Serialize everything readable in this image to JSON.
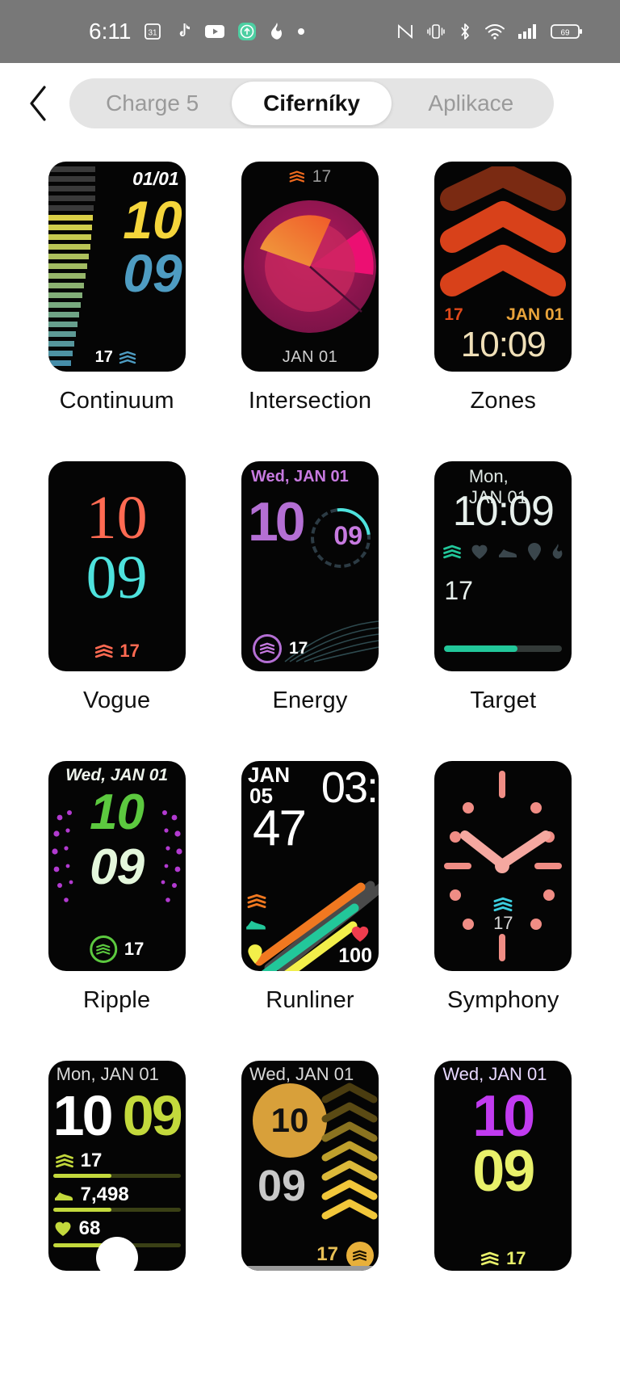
{
  "status_bar": {
    "time": "6:11",
    "left_icons": [
      "calendar-31-icon",
      "tiktok-icon",
      "youtube-icon",
      "upload-arrow-icon",
      "flame-icon",
      "dot-icon"
    ],
    "right_icons": [
      "nfc-icon",
      "vibrate-icon",
      "bluetooth-icon",
      "wifi-icon",
      "cellular-signal-icon",
      "battery-icon"
    ],
    "battery_level": "69",
    "background": "#787878"
  },
  "header": {
    "back_label": "‹",
    "tabs": [
      {
        "label": "Charge 5",
        "active": false
      },
      {
        "label": "Ciferníky",
        "active": true
      },
      {
        "label": "Aplikace",
        "active": false
      }
    ]
  },
  "watch_faces": [
    {
      "name": "Continuum",
      "date": "01/01",
      "hour": "10",
      "minute": "09",
      "stat": "17",
      "colors": {
        "hour": "#f5d53b",
        "minute": "#4e9cc2",
        "date": "#ffffff"
      }
    },
    {
      "name": "Intersection",
      "date": "JAN 01",
      "stat": "17",
      "colors": {
        "accent": "#e8542a",
        "pie_a": "#f58c3c",
        "pie_b": "#e8186c",
        "pie_c": "#8e1450"
      }
    },
    {
      "name": "Zones",
      "date": "JAN 01",
      "time": "10:09",
      "stat": "17",
      "colors": {
        "chevron": "#d8411a",
        "time": "#f0e0b8",
        "date": "#e8a33b",
        "stat": "#e0491a"
      }
    },
    {
      "name": "Vogue",
      "hour": "10",
      "minute": "09",
      "stat": "17",
      "colors": {
        "hour": "#ff6a52",
        "minute": "#4ee2dd"
      }
    },
    {
      "name": "Energy",
      "date": "Wed, JAN 01",
      "hour": "10",
      "minute": "09",
      "stat": "17",
      "colors": {
        "hour": "#b46fd4",
        "minute": "#c77ae0",
        "arc": "#4ee2dd"
      }
    },
    {
      "name": "Target",
      "date": "Mon, JAN 01",
      "time": "10:09",
      "stat": "17",
      "icons": [
        "floors-icon",
        "heart-icon",
        "shoe-icon",
        "location-icon",
        "flame-icon"
      ],
      "colors": {
        "text": "#e7f0ec",
        "progress": "#22c79a"
      }
    },
    {
      "name": "Ripple",
      "date": "Wed, JAN 01",
      "hour": "10",
      "minute": "09",
      "stat": "17",
      "colors": {
        "hour": "#5cc93f",
        "minute": "#d9f5cf",
        "dots": "#b23ad0"
      }
    },
    {
      "name": "Runliner",
      "month": "JAN",
      "day": "05",
      "hour": "03:",
      "minute": "47",
      "heart": "100",
      "colors": {
        "orange": "#f07820",
        "green": "#22c79a",
        "yellow": "#f2ef4a",
        "heart": "#ef3d4e"
      }
    },
    {
      "name": "Symphony",
      "stat": "17",
      "colors": {
        "hands": "#f5a8a0",
        "ticks": "#f08d85",
        "stat_icon": "#3ccfe0"
      }
    },
    {
      "name": "",
      "date": "Mon, JAN 01",
      "hour": "10",
      "minute": "09",
      "stats": [
        {
          "icon": "floors-icon",
          "value": "17",
          "progress": 46
        },
        {
          "icon": "shoe-icon",
          "value": "7,498",
          "progress": 46
        },
        {
          "icon": "heart-icon",
          "value": "68",
          "progress": 46
        }
      ],
      "colors": {
        "hour": "#ffffff",
        "minute": "#c3d93c",
        "accent": "#c3d93c"
      }
    },
    {
      "name": "",
      "date": "Wed, JAN 01",
      "hour": "10",
      "minute": "09",
      "stat": "17",
      "colors": {
        "hour_bg": "#d8a03a",
        "minute": "#c8c8c8",
        "chevrons": "#f2c73a"
      }
    },
    {
      "name": "",
      "date": "Wed, JAN 01",
      "hour": "10",
      "minute": "09",
      "stat": "17",
      "colors": {
        "hour": "#c13bf0",
        "minute": "#e8f06a"
      }
    }
  ]
}
